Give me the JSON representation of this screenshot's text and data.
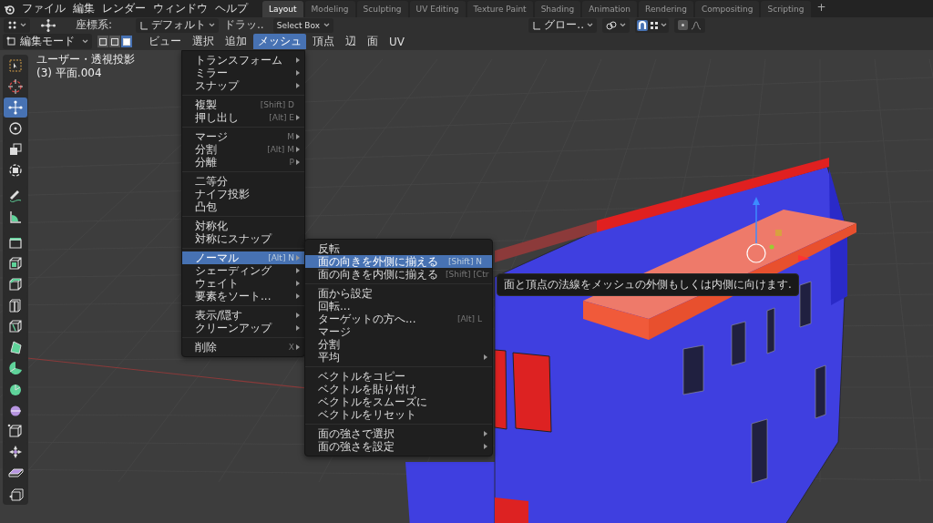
{
  "topbar": {
    "menus": [
      "ファイル",
      "編集",
      "レンダー",
      "ウィンドウ",
      "ヘルプ"
    ],
    "workspaces": [
      {
        "label": "Layout",
        "selected": true
      },
      {
        "label": "Modeling",
        "selected": false
      },
      {
        "label": "Sculpting",
        "selected": false
      },
      {
        "label": "UV Editing",
        "selected": false
      },
      {
        "label": "Texture Paint",
        "selected": false
      },
      {
        "label": "Shading",
        "selected": false
      },
      {
        "label": "Animation",
        "selected": false
      },
      {
        "label": "Rendering",
        "selected": false
      },
      {
        "label": "Compositing",
        "selected": false
      },
      {
        "label": "Scripting",
        "selected": false
      }
    ],
    "add_tab": "+"
  },
  "tool_header": {
    "coordinate_label": "座標系:",
    "orientation": "デフォルト",
    "drag_label": "ドラッ..",
    "drag_tool": "Select Box",
    "transform_orientation": "グロー..",
    "snap_on": true,
    "proportional_editing_on": false
  },
  "editor_header": {
    "mode": "編集モード",
    "select_modes": [
      {
        "selected": false
      },
      {
        "selected": false
      },
      {
        "selected": true
      }
    ],
    "menus": [
      {
        "label": "ビュー",
        "selected": false
      },
      {
        "label": "選択",
        "selected": false
      },
      {
        "label": "追加",
        "selected": false
      },
      {
        "label": "メッシュ",
        "selected": true
      },
      {
        "label": "頂点",
        "selected": false
      },
      {
        "label": "辺",
        "selected": false
      },
      {
        "label": "面",
        "selected": false
      },
      {
        "label": "UV",
        "selected": false
      }
    ]
  },
  "viewport": {
    "view_name": "ユーザー・透視投影",
    "object_name": "(3) 平面.004"
  },
  "toolbar": {
    "tools": [
      {
        "selected": false
      },
      {
        "selected": false
      },
      {
        "selected": true
      },
      {
        "selected": false
      },
      {
        "selected": false
      },
      {
        "selected": false
      },
      {
        "selected": false
      },
      {
        "selected": false
      },
      {
        "selected": false
      },
      {
        "selected": false
      },
      {
        "selected": false
      },
      {
        "selected": false
      },
      {
        "selected": false
      },
      {
        "selected": false
      },
      {
        "selected": false
      },
      {
        "selected": false
      },
      {
        "selected": false
      },
      {
        "selected": false
      },
      {
        "selected": false
      },
      {
        "selected": false
      },
      {
        "selected": false
      }
    ]
  },
  "mesh_menu": {
    "groups": [
      [
        {
          "label": "トランスフォーム",
          "submenu": true,
          "selected": false
        },
        {
          "label": "ミラー",
          "submenu": true,
          "selected": false
        },
        {
          "label": "スナップ",
          "submenu": true,
          "selected": false
        }
      ],
      [
        {
          "label": "複製",
          "shortcut": "[Shift] D",
          "submenu": false,
          "selected": false
        },
        {
          "label": "押し出し",
          "shortcut": "[Alt] E",
          "submenu": true,
          "selected": false
        }
      ],
      [
        {
          "label": "マージ",
          "shortcut": "M",
          "submenu": true,
          "selected": false
        },
        {
          "label": "分割",
          "shortcut": "[Alt] M",
          "submenu": true,
          "selected": false
        },
        {
          "label": "分離",
          "shortcut": "P",
          "submenu": true,
          "selected": false
        }
      ],
      [
        {
          "label": "二等分",
          "submenu": false,
          "selected": false
        },
        {
          "label": "ナイフ投影",
          "submenu": false,
          "selected": false
        },
        {
          "label": "凸包",
          "submenu": false,
          "selected": false
        }
      ],
      [
        {
          "label": "対称化",
          "submenu": false,
          "selected": false
        },
        {
          "label": "対称にスナップ",
          "submenu": false,
          "selected": false
        }
      ],
      [
        {
          "label": "ノーマル",
          "shortcut": "[Alt] N",
          "submenu": true,
          "selected": true
        },
        {
          "label": "シェーディング",
          "submenu": true,
          "selected": false
        },
        {
          "label": "ウェイト",
          "submenu": true,
          "selected": false
        },
        {
          "label": "要素をソート...",
          "submenu": true,
          "selected": false
        }
      ],
      [
        {
          "label": "表示/隠す",
          "submenu": true,
          "selected": false
        },
        {
          "label": "クリーンアップ",
          "submenu": true,
          "selected": false
        }
      ],
      [
        {
          "label": "削除",
          "shortcut": "X",
          "submenu": true,
          "selected": false
        }
      ]
    ]
  },
  "normals_menu": {
    "groups": [
      [
        {
          "label": "反転",
          "submenu": false,
          "selected": false
        },
        {
          "label": "面の向きを外側に揃える",
          "shortcut": "[Shift] N",
          "submenu": false,
          "selected": true
        },
        {
          "label": "面の向きを内側に揃える",
          "shortcut": "[Shift] [Ctr",
          "submenu": false,
          "selected": false
        }
      ],
      [
        {
          "label": "面から設定",
          "submenu": false,
          "selected": false
        },
        {
          "label": "回転...",
          "submenu": false,
          "selected": false
        },
        {
          "label": "ターゲットの方へ...",
          "shortcut": "[Alt] L",
          "submenu": false,
          "selected": false
        },
        {
          "label": "マージ",
          "submenu": false,
          "selected": false
        },
        {
          "label": "分割",
          "submenu": false,
          "selected": false
        },
        {
          "label": "平均",
          "submenu": true,
          "selected": false
        }
      ],
      [
        {
          "label": "ベクトルをコピー",
          "submenu": false,
          "selected": false
        },
        {
          "label": "ベクトルを貼り付け",
          "submenu": false,
          "selected": false
        },
        {
          "label": "ベクトルをスムーズに",
          "submenu": false,
          "selected": false
        },
        {
          "label": "ベクトルをリセット",
          "submenu": false,
          "selected": false
        }
      ],
      [
        {
          "label": "面の強さで選択",
          "submenu": true,
          "selected": false
        },
        {
          "label": "面の強さを設定",
          "submenu": true,
          "selected": false
        }
      ]
    ]
  },
  "tooltip": "面と頂点の法線をメッシュの外側もしくは内側に向けます."
}
